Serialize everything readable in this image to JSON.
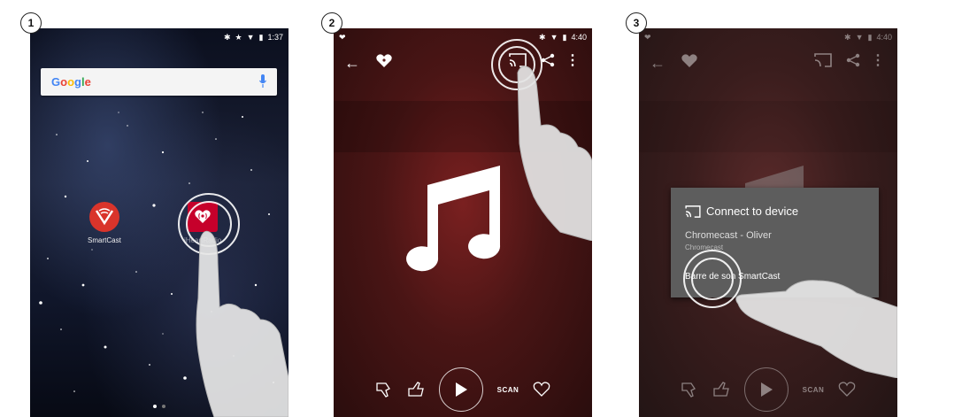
{
  "steps": [
    "1",
    "2",
    "3"
  ],
  "screen1": {
    "status_time": "1:37",
    "search_brand": "Google",
    "apps": [
      {
        "label": "SmartCast"
      },
      {
        "label": "iHeartRadio"
      }
    ]
  },
  "screen2": {
    "status_time": "4:40",
    "controls": {
      "scan_label": "SCAN"
    }
  },
  "screen3": {
    "status_time": "4:40",
    "dialog": {
      "title": "Connect to device",
      "devices": [
        {
          "name": "Chromecast - Oliver",
          "subtitle": "Chromecast"
        },
        {
          "name": "Barre de son SmartCast"
        }
      ]
    },
    "controls": {
      "scan_label": "SCAN"
    }
  },
  "colors": {
    "google_blue": "#4285F4",
    "google_red": "#EA4335",
    "google_yellow": "#FBBC05",
    "google_green": "#34A853",
    "smartcast_red": "#d9342b",
    "iheart_red": "#c6002b",
    "mic_blue": "#4285F4"
  },
  "icons": [
    "bluetooth-icon",
    "star-icon",
    "wifi-icon",
    "battery-icon",
    "mic-icon",
    "back-arrow-icon",
    "iheart-logo-icon",
    "cast-icon",
    "share-icon",
    "more-vert-icon",
    "thumbs-down-icon",
    "thumbs-up-icon",
    "play-icon",
    "heart-icon",
    "music-note-icon",
    "hand-pointer-icon"
  ]
}
